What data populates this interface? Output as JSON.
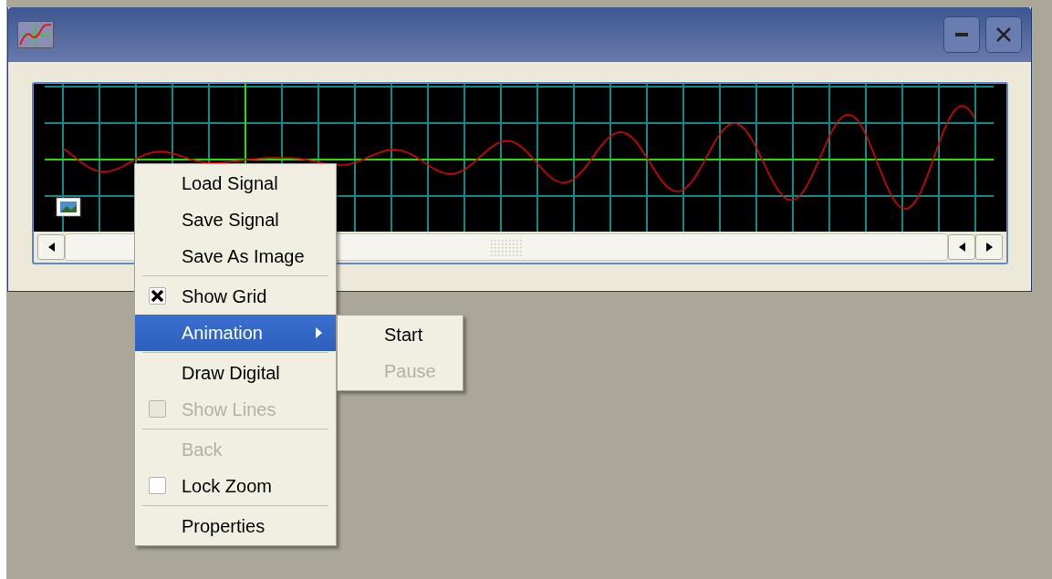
{
  "window": {
    "controls": [
      {
        "kind": "minimize"
      },
      {
        "kind": "close"
      }
    ]
  },
  "context_menu": {
    "items": [
      {
        "kind": "item",
        "label": "Load Signal",
        "disabled": false,
        "selected": false
      },
      {
        "kind": "item",
        "label": "Save Signal",
        "disabled": false,
        "selected": false
      },
      {
        "kind": "item",
        "label": "Save As Image",
        "disabled": false,
        "selected": false
      },
      {
        "kind": "separator"
      },
      {
        "kind": "check",
        "label": "Show Grid",
        "checked": true,
        "disabled": false,
        "selected": false
      },
      {
        "kind": "submenu",
        "label": "Animation",
        "disabled": false,
        "selected": true
      },
      {
        "kind": "separator"
      },
      {
        "kind": "item",
        "label": "Draw Digital",
        "disabled": false,
        "selected": false
      },
      {
        "kind": "check",
        "label": "Show Lines",
        "checked": false,
        "disabled": true,
        "selected": false
      },
      {
        "kind": "separator"
      },
      {
        "kind": "item",
        "label": "Back",
        "disabled": true,
        "selected": false
      },
      {
        "kind": "check",
        "label": "Lock Zoom",
        "checked": false,
        "disabled": false,
        "selected": false
      },
      {
        "kind": "separator"
      },
      {
        "kind": "item",
        "label": "Properties",
        "disabled": false,
        "selected": false
      }
    ]
  },
  "submenu": {
    "items": [
      {
        "label": "Start",
        "disabled": false,
        "selected": false
      },
      {
        "label": "Pause",
        "disabled": true,
        "selected": false
      }
    ]
  }
}
